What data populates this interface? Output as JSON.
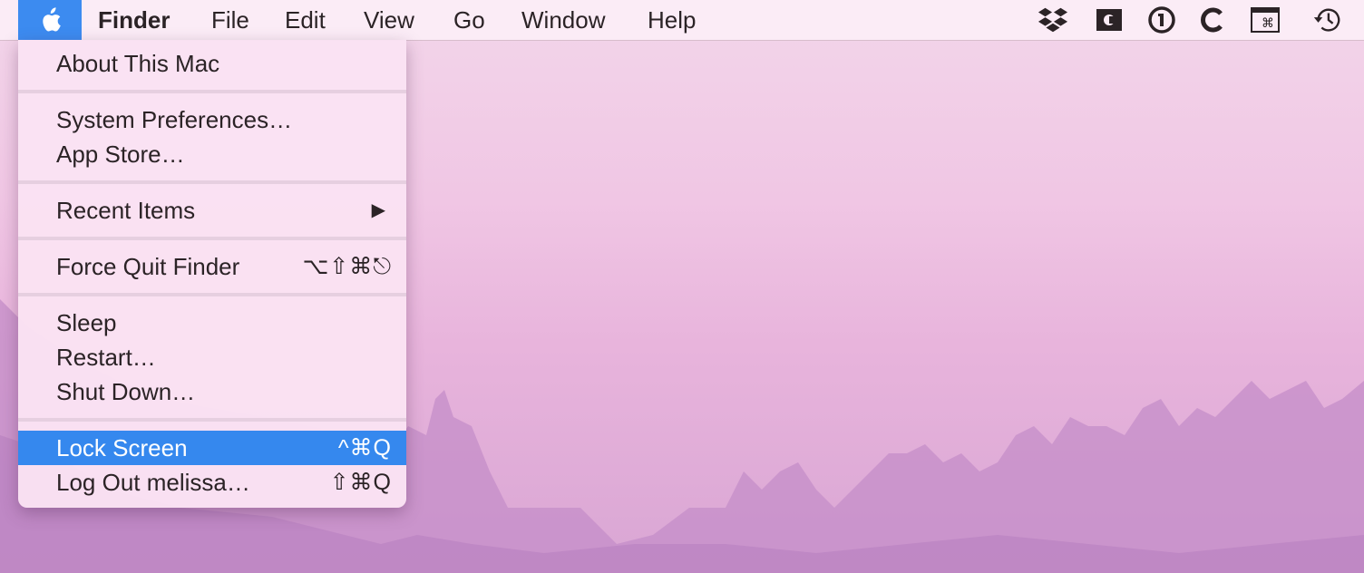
{
  "menubar": {
    "apple_icon": "apple-logo-icon",
    "app_name": "Finder",
    "items": [
      "File",
      "Edit",
      "View",
      "Go",
      "Window",
      "Help"
    ],
    "status_icons": [
      "dropbox-icon",
      "cardhop-icon",
      "1password-icon",
      "c-app-icon",
      "command-keyboard-icon",
      "time-machine-icon"
    ]
  },
  "apple_menu": {
    "about": "About This Mac",
    "system_preferences": "System Preferences…",
    "app_store": "App Store…",
    "recent_items": "Recent Items",
    "recent_items_arrow": "▶",
    "force_quit": "Force Quit Finder",
    "force_quit_shortcut": "⌥⇧⌘⎋",
    "sleep": "Sleep",
    "restart": "Restart…",
    "shut_down": "Shut Down…",
    "lock_screen": "Lock Screen",
    "lock_screen_shortcut": "^⌘Q",
    "log_out": "Log Out melissa…",
    "log_out_shortcut": "⇧⌘Q",
    "highlighted_item": "Lock Screen",
    "highlight_color": "#3588ee"
  }
}
